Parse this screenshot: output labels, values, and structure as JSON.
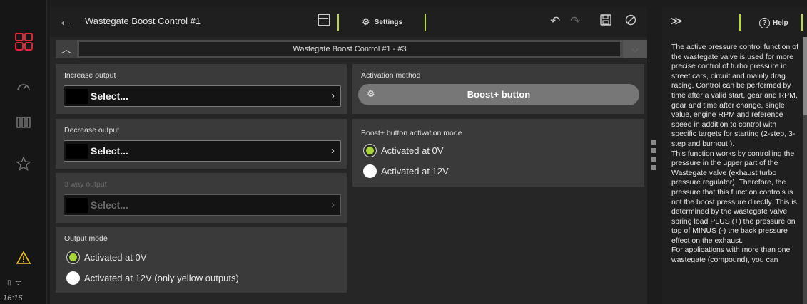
{
  "app": {
    "title": "Wastegate Boost Control #1",
    "settings_label": "Settings",
    "section_bar_label": "Wastegate Boost Control #1 - #3",
    "clock": "16:16"
  },
  "colors": {
    "accent": "#b6e022",
    "radio_on": "#a6d43a",
    "warning": "#f0c419",
    "rail_logo": "#e0253a"
  },
  "rail": {
    "icons": [
      "grid-logo-icon",
      "gauge-icon",
      "columns-icon",
      "star-icon",
      "warning-icon",
      "battery-icon",
      "wifi-icon"
    ]
  },
  "left_panels": {
    "increase": {
      "label": "Increase output",
      "value": "Select..."
    },
    "decrease": {
      "label": "Decrease output",
      "value": "Select..."
    },
    "three_way": {
      "label": "3 way output",
      "value": "Select..."
    },
    "output_mode": {
      "label": "Output mode",
      "options": [
        {
          "label": "Activated at 0V",
          "selected": true
        },
        {
          "label": "Activated at 12V (only yellow outputs)",
          "selected": false
        }
      ]
    }
  },
  "right_panels": {
    "activation": {
      "label": "Activation method",
      "button_label": "Boost+ button"
    },
    "boost_mode": {
      "label": "Boost+ button activation mode",
      "options": [
        {
          "label": "Activated at 0V",
          "selected": true
        },
        {
          "label": "Activated at 12V",
          "selected": false
        }
      ]
    }
  },
  "help": {
    "button_label": "Help",
    "text": "The active pressure control function of the wastegate valve is used for more precise control of turbo pressure in street cars, circuit and mainly drag racing. Control can be performed by time after a valid start, gear and RPM, gear and time after change, single value, engine RPM and reference speed in addition to control with specific targets for starting (2-step, 3-step and burnout ).\nThis function works by controlling the pressure in the upper part of the Wastegate valve (exhaust turbo pressure regulator). Therefore, the pressure that this function controls is not the boost pressure directly. This is determined by the wastegate valve spring load PLUS (+) the pressure on top of MINUS (-) the back pressure effect on the exhaust.\nFor applications with more than one wastegate (compound), you can"
  }
}
